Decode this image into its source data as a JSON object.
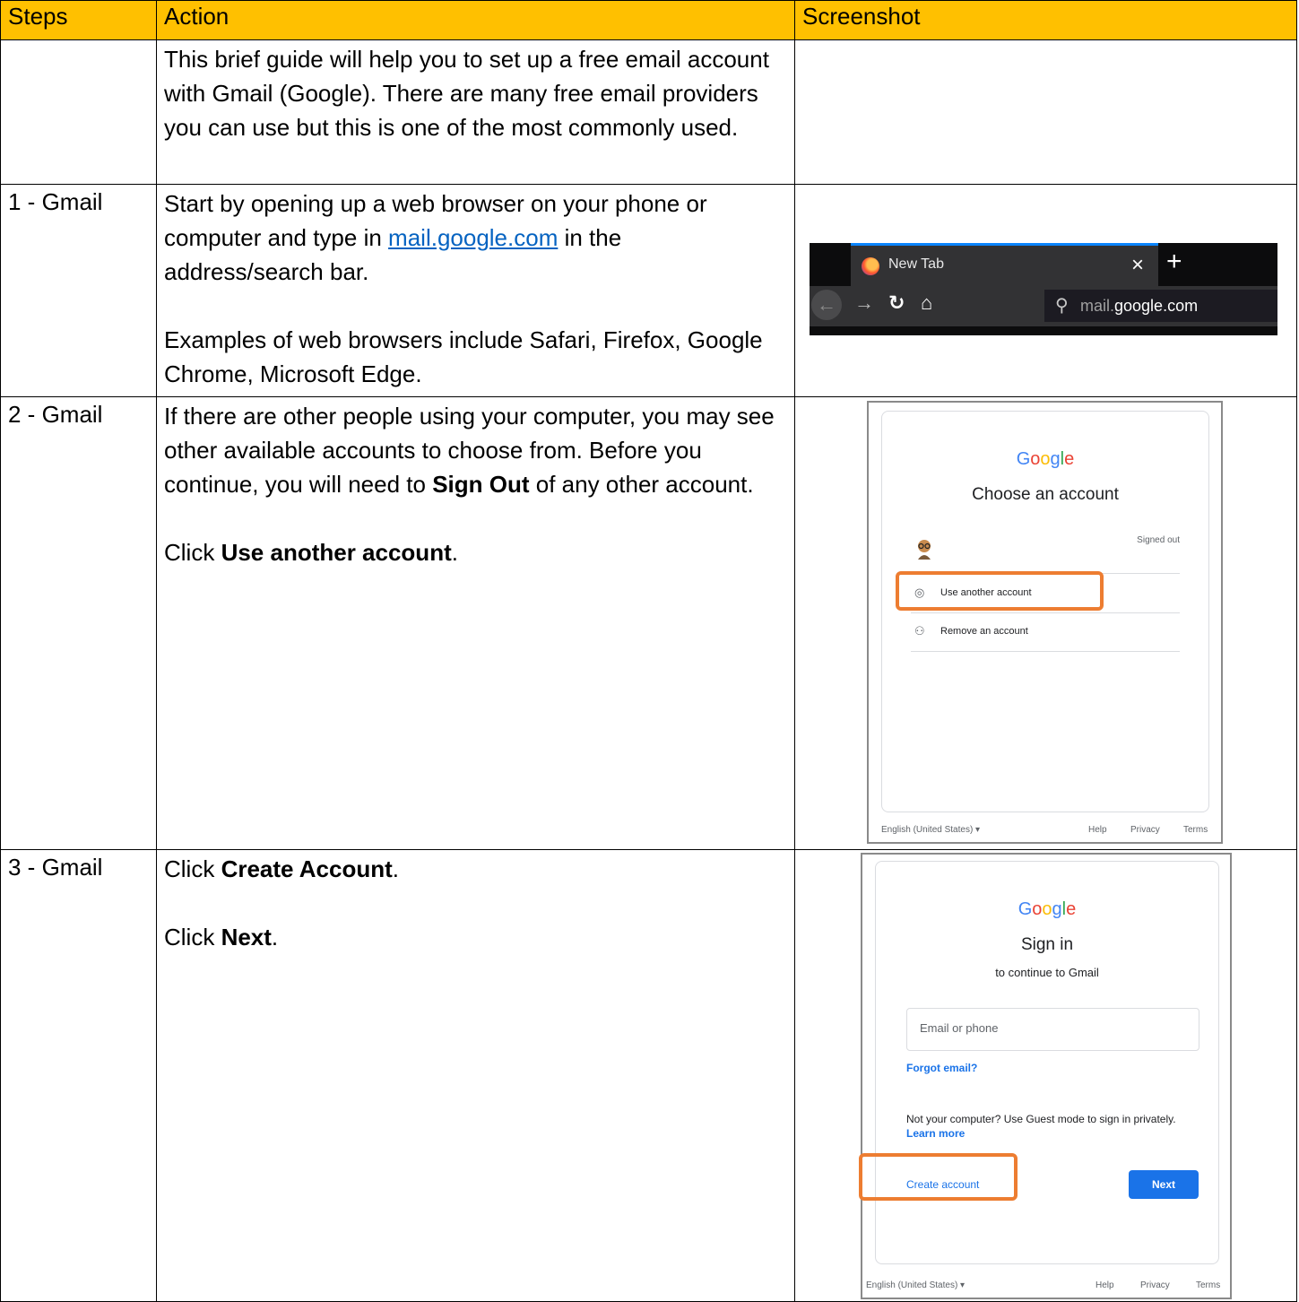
{
  "headers": {
    "steps": "Steps",
    "action": "Action",
    "screenshot": "Screenshot"
  },
  "rows": [
    {
      "step": "",
      "action": "This brief guide will help you to set up a free email account with Gmail (Google). There are many free email providers you can use but this is one of the most commonly used."
    },
    {
      "step": "1 - Gmail",
      "action_pre": "Start by opening up a web browser on your phone or computer and type in ",
      "action_link": "mail.google.com",
      "action_post": " in the address/search bar.",
      "action_2": "Examples of web browsers include Safari, Firefox, Google Chrome, Microsoft Edge."
    },
    {
      "step": "2 - Gmail",
      "action_pre": "If there are other people using your computer, you may see other available accounts to choose from. Before you continue, you will need to ",
      "action_bold": "Sign Out",
      "action_post": " of any other account.",
      "action_2_pre": "Click ",
      "action_2_bold": "Use another account",
      "action_2_post": "."
    },
    {
      "step": "3 - Gmail",
      "action_1_pre": "Click ",
      "action_1_bold": "Create Account",
      "action_1_post": ".",
      "action_2_pre": "Click ",
      "action_2_bold": "Next",
      "action_2_post": "."
    }
  ],
  "browser_shot": {
    "tab_title": "New Tab",
    "tab_close": "×",
    "new_tab": "+",
    "url_dim": "mail.",
    "url_main": "google.com",
    "icons": [
      "firefox-icon",
      "back-arrow-icon",
      "forward-arrow-icon",
      "reload-icon",
      "home-icon",
      "search-icon"
    ]
  },
  "choose_account_shot": {
    "logo": "Google",
    "title": "Choose an account",
    "signed_out": "Signed out",
    "use_another": "Use another account",
    "remove": "Remove an account",
    "language": "English (United States) ▾",
    "help": "Help",
    "privacy": "Privacy",
    "terms": "Terms"
  },
  "signin_shot": {
    "logo": "Google",
    "title": "Sign in",
    "subtitle": "to continue to Gmail",
    "email_placeholder": "Email or phone",
    "forgot": "Forgot email?",
    "guest_text": "Not your computer? Use Guest mode to sign in privately.",
    "learn_more": "Learn more",
    "create": "Create account",
    "next": "Next",
    "language": "English (United States) ▾",
    "help": "Help",
    "privacy": "Privacy",
    "terms": "Terms"
  },
  "colors": {
    "header_bg": "#FFC000",
    "highlight": "#ED7D31",
    "link": "#0563C1",
    "google_blue": "#1a73e8"
  }
}
